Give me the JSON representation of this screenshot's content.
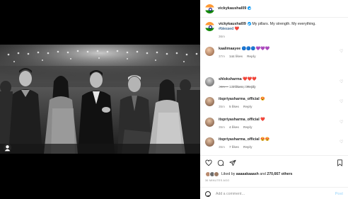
{
  "post": {
    "username": "vickykaushal09",
    "caption": "My pillars. My strength. My everything.",
    "hashtag": "#blessed",
    "caption_emoji": "❤️",
    "caption_time": "36m"
  },
  "comments": [
    {
      "user": "kaalimaayee",
      "text": "🔵🔵🔵💜💜💜",
      "time": "37m",
      "likes": "144 likes",
      "reply": "Reply"
    },
    {
      "user": "shloksharma",
      "text": "❤️❤️❤️",
      "time": "28m",
      "likes": "133 likes",
      "reply": "Reply"
    },
    {
      "user": "itspriyasharma_official",
      "text": "😍",
      "time": "35m",
      "likes": "5 likes",
      "reply": "Reply"
    },
    {
      "user": "itspriyasharma_official",
      "text": "❤️",
      "time": "35m",
      "likes": "4 likes",
      "reply": "Reply"
    },
    {
      "user": "itspriyasharma_official",
      "text": "😍😍",
      "time": "35m",
      "likes": "7 likes",
      "reply": "Reply"
    }
  ],
  "view_replies": "View replies (1)",
  "likes": {
    "prefix": "Liked by",
    "by": "aaaaakaaash",
    "and": "and",
    "others": "270,667 others"
  },
  "timestamp": "36 MINUTES AGO",
  "add_comment": {
    "placeholder": "Add a comment…",
    "post_label": "Post"
  },
  "icons": {
    "heart": "heart-icon",
    "comment": "comment-icon",
    "share": "share-icon",
    "save": "bookmark-icon",
    "emoji": "emoji-icon",
    "tag": "user-tag-icon"
  },
  "colors": {
    "verified": "#0095f6",
    "post_disabled": "#b2dffc",
    "muted": "#8e8e8e",
    "text": "#262626"
  }
}
